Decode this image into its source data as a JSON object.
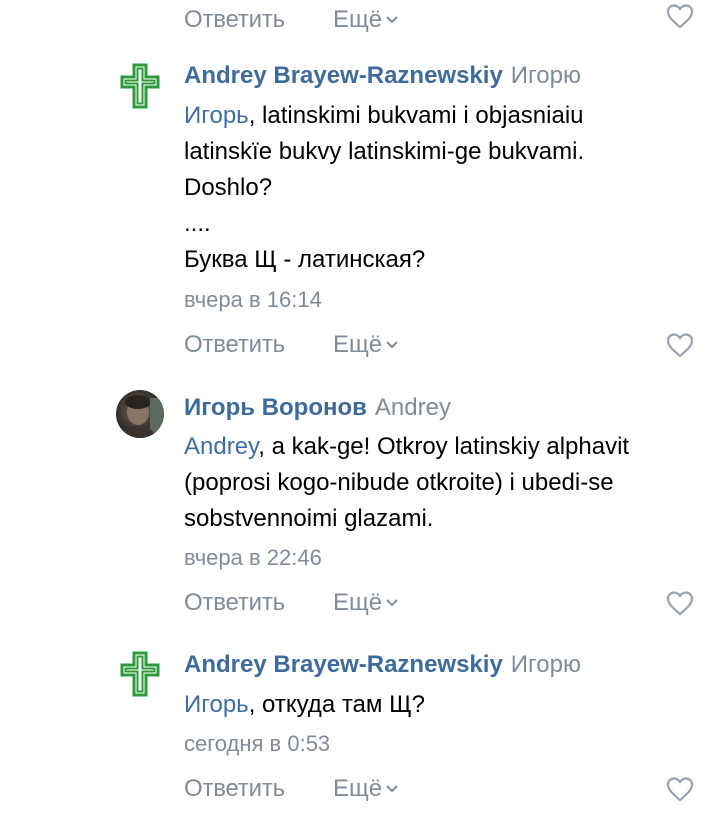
{
  "actions": {
    "reply_label": "Ответить",
    "more_label": "Ещё"
  },
  "comments": [
    {
      "author": "Andrey Brayew-Raznewskiy",
      "reply_to": "Игорю",
      "mention": "Игорь",
      "lines": [
        ", latinskimi bukvami i objasniaiu",
        "latinskïe bukvy latinskimi-ge bukvami.",
        "Doshlo?",
        "....",
        "Буква Щ - латинская?"
      ],
      "time": "вчера в 16:14",
      "avatar": "cross-icon"
    },
    {
      "author": "Игорь Воронов",
      "reply_to": "Andrey",
      "mention": "Andrey",
      "lines": [
        ", a kak-ge! Otkroy latinskiy alphavit",
        "(poprosi kogo-nibude otkroite) i ubedi-se",
        "sobstvennoimi glazami."
      ],
      "time": "вчера в 22:46",
      "avatar": "user-photo"
    },
    {
      "author": "Andrey Brayew-Raznewskiy",
      "reply_to": "Игорю",
      "mention": "Игорь",
      "lines": [
        ", откуда там Щ?"
      ],
      "time": "сегодня в 0:53",
      "avatar": "cross-icon"
    }
  ],
  "colors": {
    "author_link": "#3f6b9b",
    "secondary": "#818c99",
    "cross_green": "#2e9b3a"
  }
}
